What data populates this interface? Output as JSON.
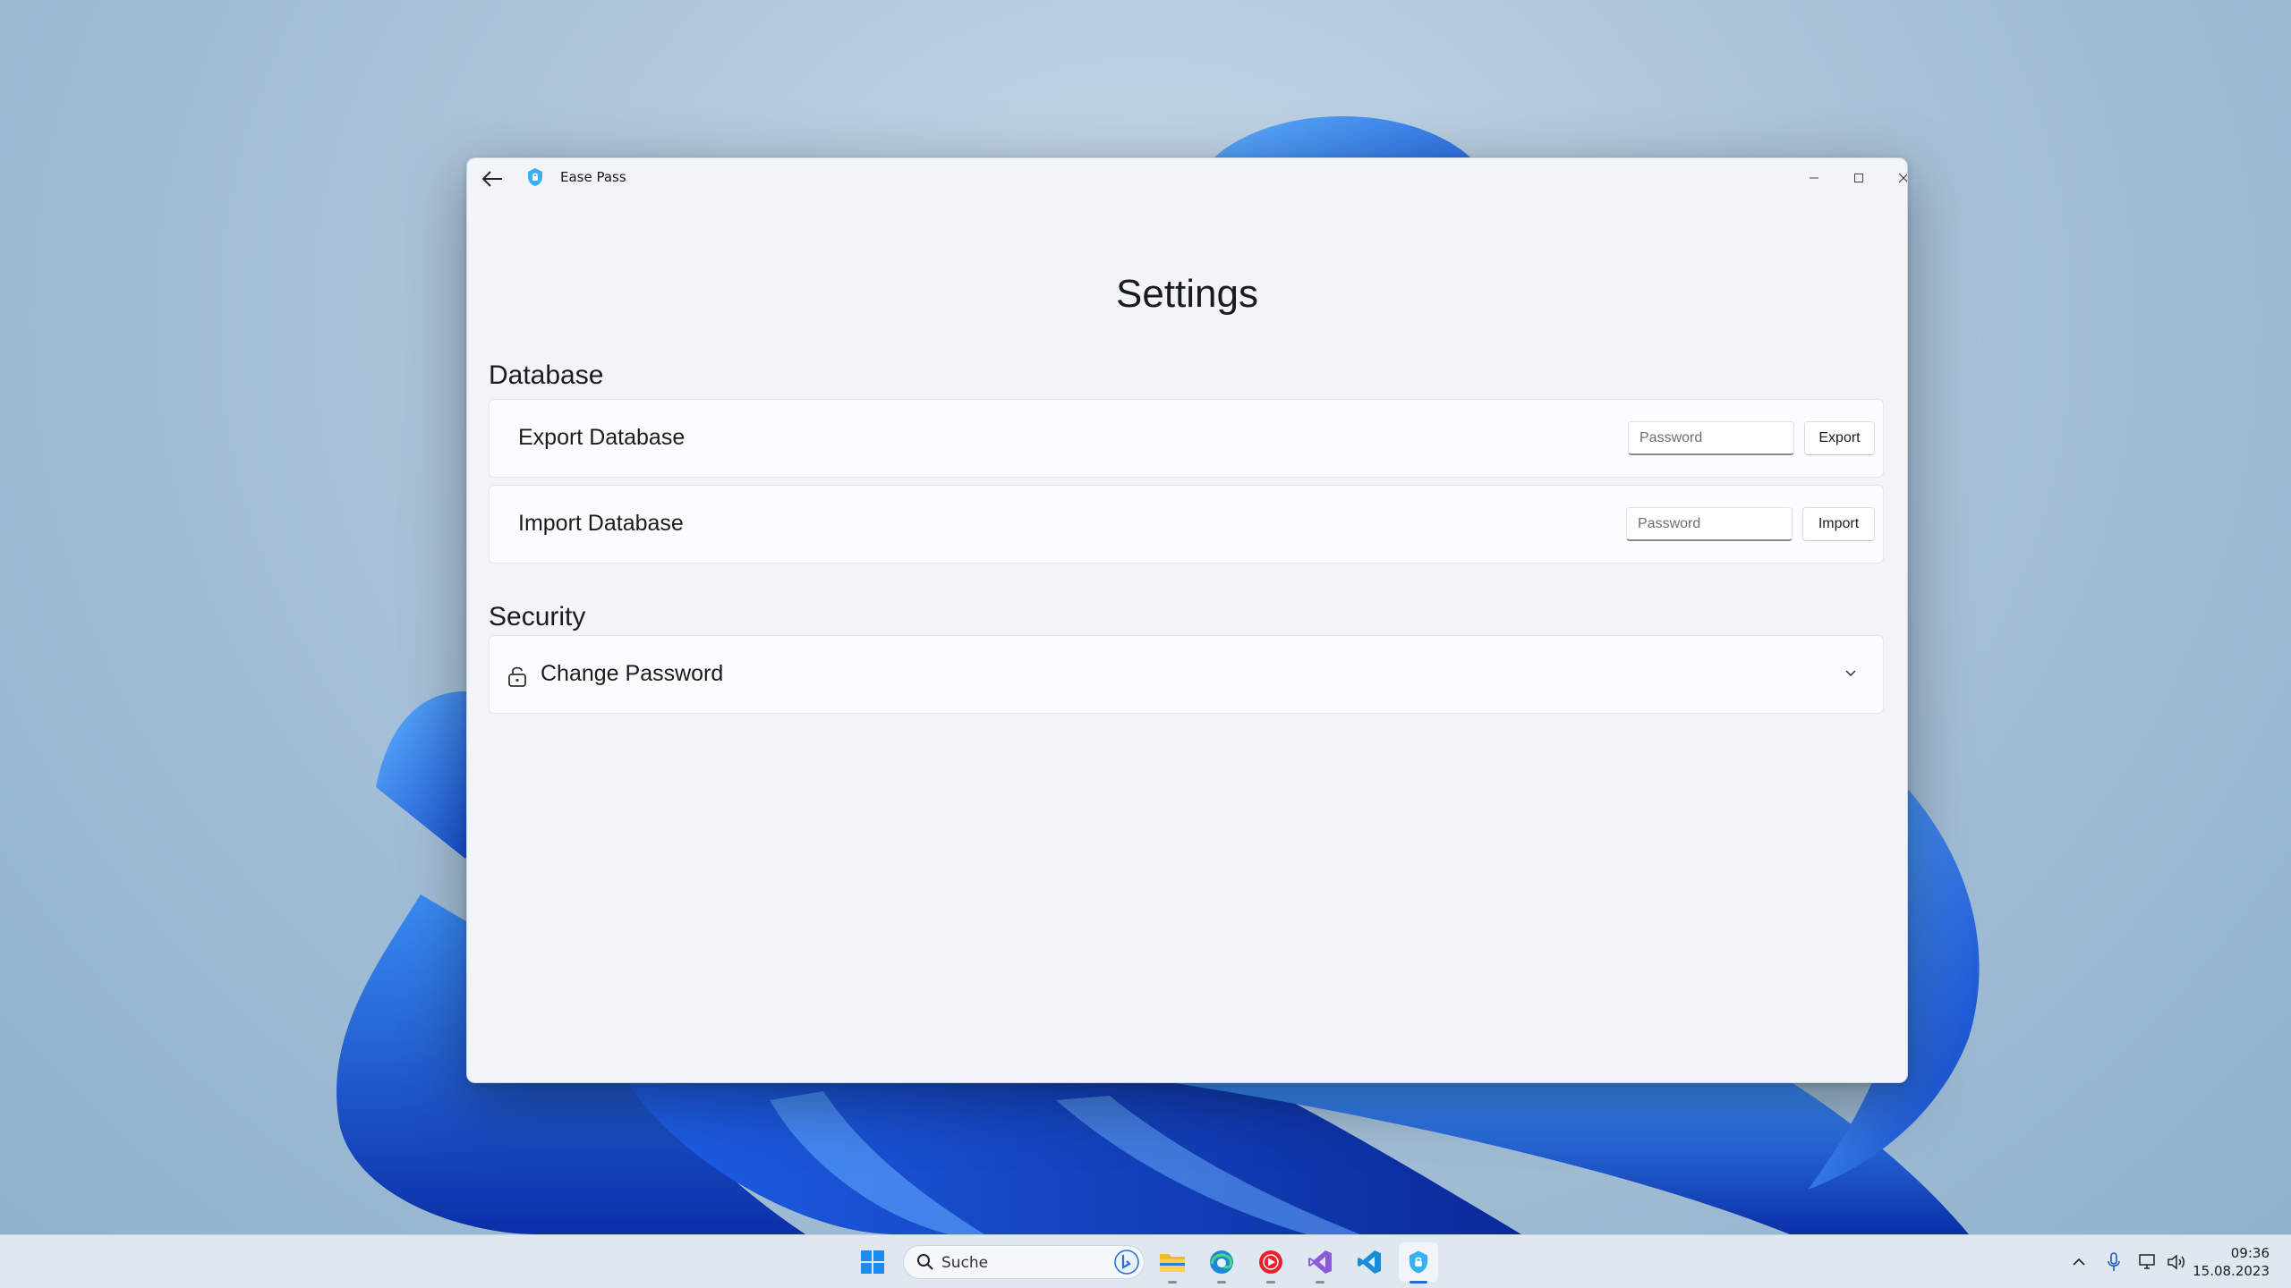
{
  "window": {
    "app_title": "Ease Pass"
  },
  "page": {
    "title": "Settings"
  },
  "database_section": {
    "header": "Database",
    "export": {
      "label": "Export Database",
      "password_placeholder": "Password",
      "button_label": "Export"
    },
    "import": {
      "label": "Import Database",
      "password_placeholder": "Password",
      "button_label": "Import"
    }
  },
  "security_section": {
    "header": "Security",
    "change_password": {
      "label": "Change Password"
    }
  },
  "taskbar": {
    "search_label": "Suche",
    "pinned_apps": [
      "start-icon",
      "file-explorer-icon",
      "edge-icon",
      "youtube-music-icon",
      "visual-studio-icon",
      "vscode-icon",
      "ease-pass-icon"
    ],
    "active_app": "Ease Pass"
  },
  "system_tray": {
    "time": "09:36",
    "date": "15.08.2023"
  },
  "colors": {
    "accent": "#1a73d0",
    "window_bg": "#f1f4f8",
    "card_bg": "#fafcfe"
  }
}
